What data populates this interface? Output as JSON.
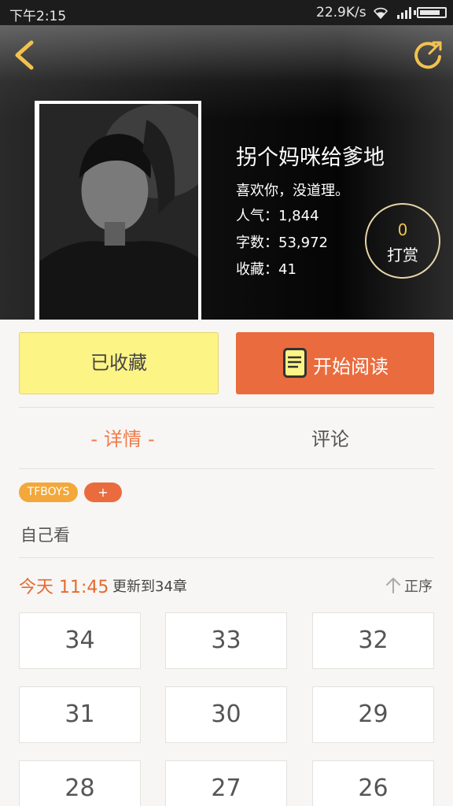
{
  "status_bar": {
    "time": "下午2:15",
    "speed": "22.9K/s",
    "battery_level": 0.85
  },
  "header": {
    "back_icon": "chevron-left-icon",
    "share_icon": "share-icon",
    "accent_color": "#f3c24d"
  },
  "book": {
    "title": "拐个妈咪给爹地",
    "description": "喜欢你，没道理。",
    "stats": [
      {
        "label": "人气：",
        "value": "1,844"
      },
      {
        "label": "字数：",
        "value": "53,972"
      },
      {
        "label": "收藏：",
        "value": "41"
      }
    ],
    "reward": {
      "count": "0",
      "label": "打赏"
    }
  },
  "actions": {
    "collected_label": "已收藏",
    "read_label": "开始阅读",
    "collected_color": "#fdf486",
    "read_color": "#ea6c3e"
  },
  "tabs": {
    "detail": "详情",
    "detail_dash": "-",
    "comments": "评论"
  },
  "tags": [
    {
      "label": "TFBOYS",
      "color": "#f2a83a"
    },
    {
      "label": "+",
      "color": "#ea6c3e"
    }
  ],
  "intro": "自己看",
  "update": {
    "time": "今天 11:45",
    "info": "更新到34章",
    "sort_label": "正序"
  },
  "chapters": [
    "34",
    "33",
    "32",
    "31",
    "30",
    "29",
    "28",
    "27",
    "26"
  ]
}
